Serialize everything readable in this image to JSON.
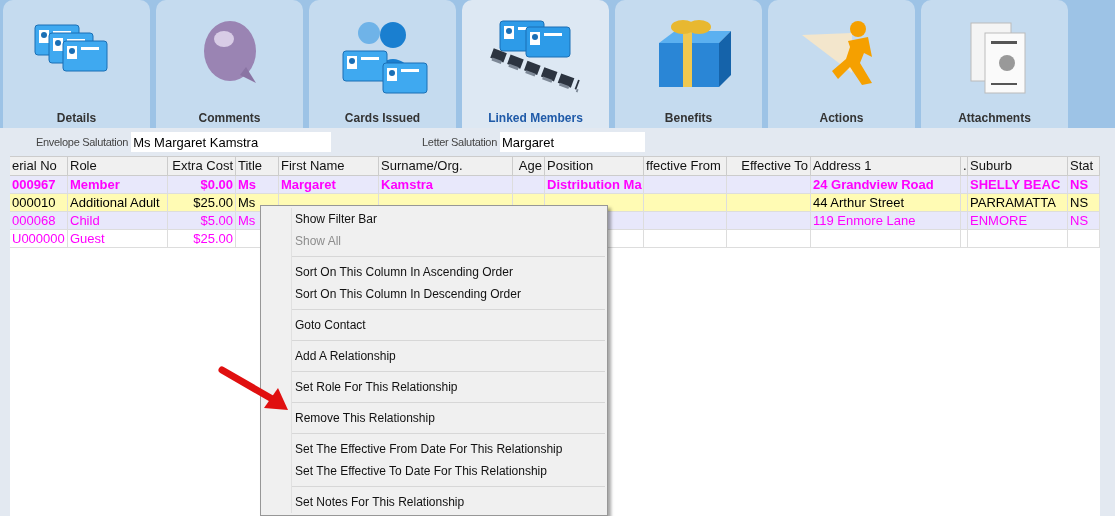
{
  "tabs": [
    {
      "label": "Details",
      "kind": "cards",
      "selected": false
    },
    {
      "label": "Comments",
      "kind": "bubble",
      "selected": false
    },
    {
      "label": "Cards Issued",
      "kind": "people",
      "selected": false
    },
    {
      "label": "Linked Members",
      "kind": "chain",
      "selected": true
    },
    {
      "label": "Benefits",
      "kind": "gift",
      "selected": false
    },
    {
      "label": "Actions",
      "kind": "runner",
      "selected": false
    },
    {
      "label": "Attachments",
      "kind": "papers",
      "selected": false
    }
  ],
  "salutations": [
    {
      "label": "Envelope Salutation",
      "value": "Ms Margaret Kamstra"
    },
    {
      "label": "Letter Salutation",
      "value": "Margaret"
    }
  ],
  "table": {
    "columns": [
      {
        "label": "erial No"
      },
      {
        "label": "Role"
      },
      {
        "label": "Extra Cost"
      },
      {
        "label": "Title"
      },
      {
        "label": "First Name"
      },
      {
        "label": "Surname/Org."
      },
      {
        "label": "Age"
      },
      {
        "label": "Position"
      },
      {
        "label": "ffective From"
      },
      {
        "label": "Effective To"
      },
      {
        "label": "Address 1"
      },
      {
        "label": "."
      },
      {
        "label": "Suburb"
      },
      {
        "label": "Stat"
      }
    ],
    "rows": [
      {
        "selected": false,
        "shaded": true,
        "color": "#ff00ff",
        "bold": true,
        "cells": [
          "000967",
          "Member",
          "$0.00",
          "Ms",
          "Margaret",
          "Kamstra",
          "",
          "Distribution Ma",
          "",
          "",
          "24 Grandview Road",
          "",
          "SHELLY BEAC",
          "NS"
        ]
      },
      {
        "selected": true,
        "color": "#000000",
        "bold": false,
        "cells": [
          "000010",
          "Additional Adult",
          "$25.00",
          "Ms",
          "",
          "",
          "",
          "",
          "",
          "",
          "44 Arthur Street",
          "",
          "PARRAMATTA",
          "NS"
        ]
      },
      {
        "selected": false,
        "shaded": true,
        "color": "#ff00ff",
        "bold": false,
        "cells": [
          "000068",
          "Child",
          "$5.00",
          "Ms",
          "",
          "",
          "",
          "",
          "",
          "",
          "119 Enmore Lane",
          "",
          "ENMORE",
          "NS"
        ]
      },
      {
        "selected": false,
        "shaded": false,
        "color": "#ff00ff",
        "bold": false,
        "cells": [
          "U000000",
          "Guest",
          "$25.00",
          "",
          "",
          "",
          "",
          "",
          "",
          "",
          "",
          "",
          "",
          ""
        ]
      }
    ]
  },
  "context_menu": {
    "sections": [
      [
        {
          "label": "Show Filter Bar",
          "disabled": false
        },
        {
          "label": "Show All",
          "disabled": true
        }
      ],
      [
        {
          "label": "Sort On This Column In Ascending Order",
          "disabled": false
        },
        {
          "label": "Sort On This Column In Descending Order",
          "disabled": false
        }
      ],
      [
        {
          "label": "Goto Contact",
          "disabled": false
        }
      ],
      [
        {
          "label": "Add A Relationship",
          "disabled": false
        }
      ],
      [
        {
          "label": "Set Role For This Relationship",
          "disabled": false
        }
      ],
      [
        {
          "label": "Remove This Relationship",
          "disabled": false
        }
      ],
      [
        {
          "label": "Set The Effective From Date For This Relationship",
          "disabled": false
        },
        {
          "label": "Set The Effective To Date For This Relationship",
          "disabled": false
        }
      ],
      [
        {
          "label": "Set Notes For This Relationship",
          "disabled": false
        }
      ]
    ]
  }
}
